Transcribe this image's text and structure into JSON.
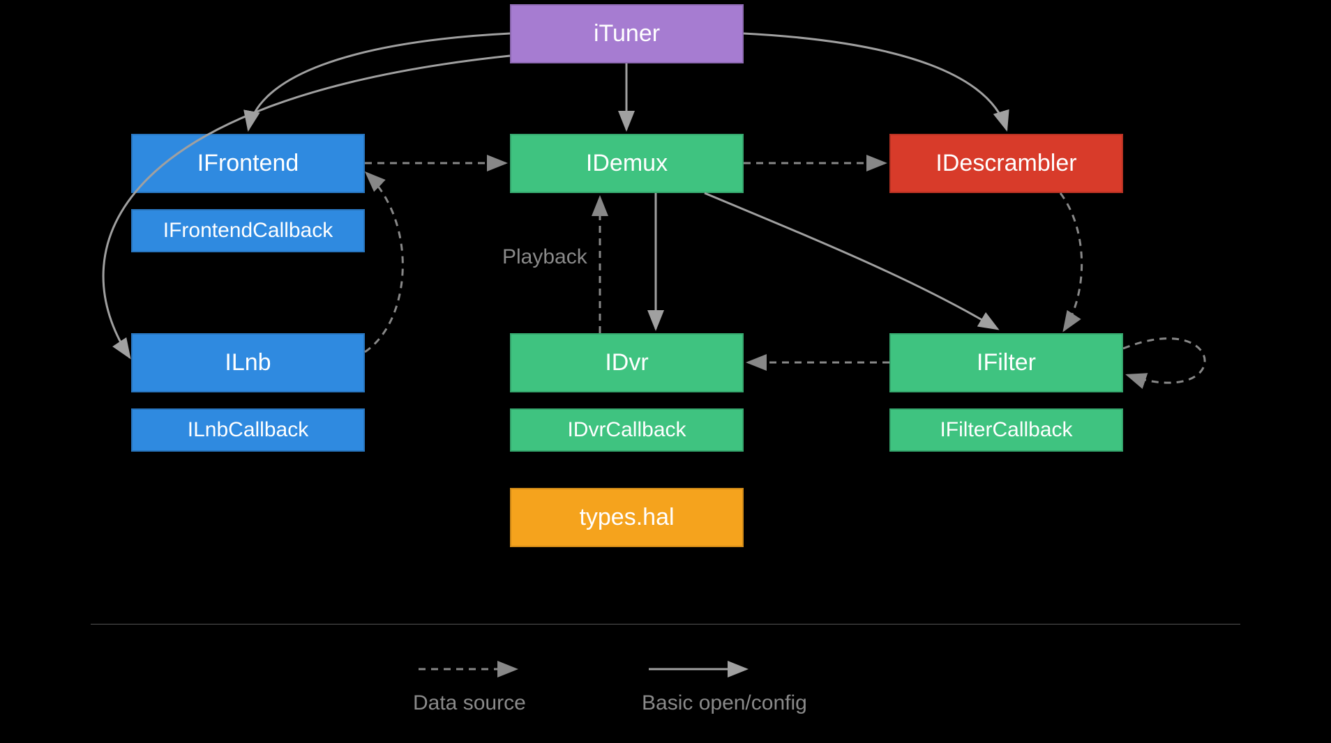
{
  "nodes": {
    "ituner": "iTuner",
    "ifrontend": "IFrontend",
    "ifrontendcb": "IFrontendCallback",
    "ilnb": "ILnb",
    "ilnbcb": "ILnbCallback",
    "idemux": "IDemux",
    "idvr": "IDvr",
    "idvrcb": "IDvrCallback",
    "typeshal": "types.hal",
    "idescrambler": "IDescrambler",
    "ifilter": "IFilter",
    "ifiltercb": "IFilterCallback"
  },
  "labels": {
    "playback": "Playback"
  },
  "legend": {
    "data_source": "Data source",
    "basic_open": "Basic open/config"
  },
  "colors": {
    "purple": "#a67cd1",
    "blue": "#2f8ae0",
    "green": "#3fc380",
    "red": "#d83b2a",
    "orange": "#f5a31d",
    "arrow": "#a0a0a0",
    "arrow_dash": "#888888"
  }
}
